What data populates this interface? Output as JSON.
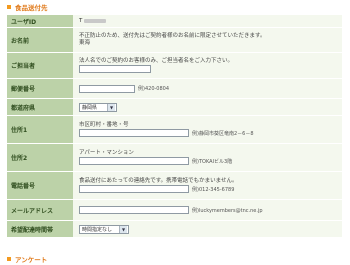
{
  "section_title": "食品送付先",
  "footer_title": "アンケート",
  "rows": {
    "userid": {
      "label": "ユーザID",
      "prefix": "T"
    },
    "name": {
      "label": "お名前",
      "note": "不正防止のため、送付先はご契約者様のお名前に限定させていただきます。",
      "value": "東海"
    },
    "contact": {
      "label": "ご担当者",
      "note": "法人名でのご契約のお客様のみ、ご担当者名をご入力下さい。"
    },
    "zip": {
      "label": "郵便番号",
      "example": "例)420-0804"
    },
    "pref": {
      "label": "都道府県",
      "selected": "静岡県"
    },
    "addr1": {
      "label": "住所1",
      "note": "市区町村・番地・号",
      "example": "例)静岡市葵区竜南2－6－8"
    },
    "addr2": {
      "label": "住所2",
      "note": "アパート・マンション",
      "example": "例)TOKAIビル3階"
    },
    "tel": {
      "label": "電話番号",
      "note": "食品送付にあたっての連絡先です。携帯電話でもかまいません。",
      "example": "例)012-345-6789"
    },
    "mail": {
      "label": "メールアドレス",
      "example": "例)luckymembers@tnc.ne.jp"
    },
    "time": {
      "label": "希望配達時間帯",
      "selected": "時間指定なし"
    }
  }
}
